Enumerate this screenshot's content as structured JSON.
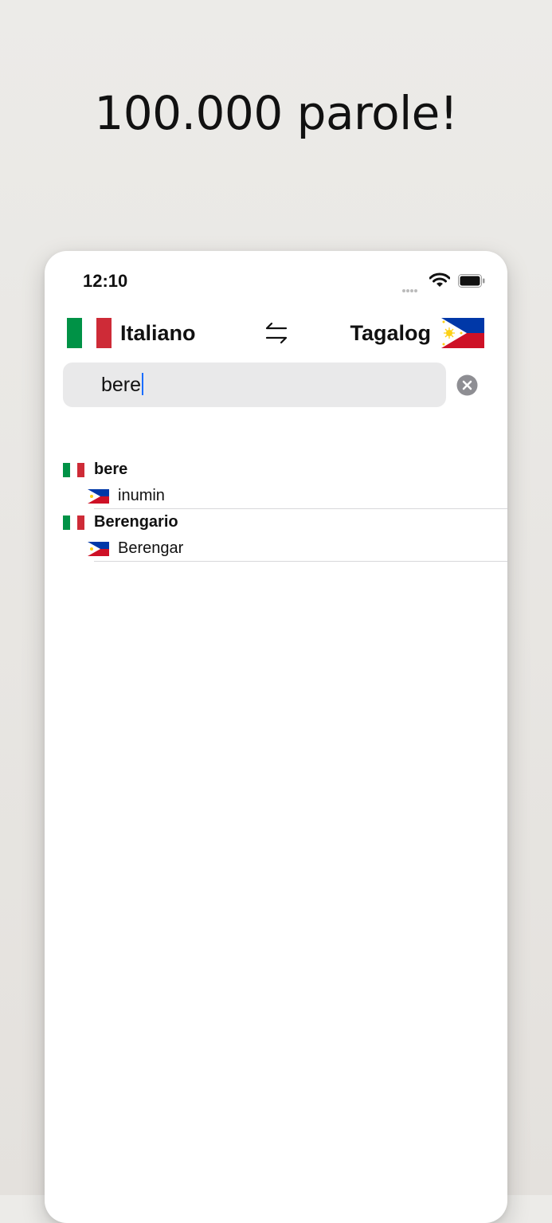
{
  "headline": "100.000 parole!",
  "status": {
    "time": "12:10"
  },
  "lang_bar": {
    "source_label": "Italiano",
    "target_label": "Tagalog"
  },
  "search": {
    "value": "bere"
  },
  "results": [
    {
      "word": "bere",
      "translation": "inumin"
    },
    {
      "word": "Berengario",
      "translation": "Berengar"
    }
  ],
  "colors": {
    "caret": "#1a6dff",
    "it_green": "#009246",
    "it_red": "#ce2b37",
    "ph_blue": "#0038a8",
    "ph_red": "#ce1126",
    "ph_sun": "#fcd116"
  }
}
